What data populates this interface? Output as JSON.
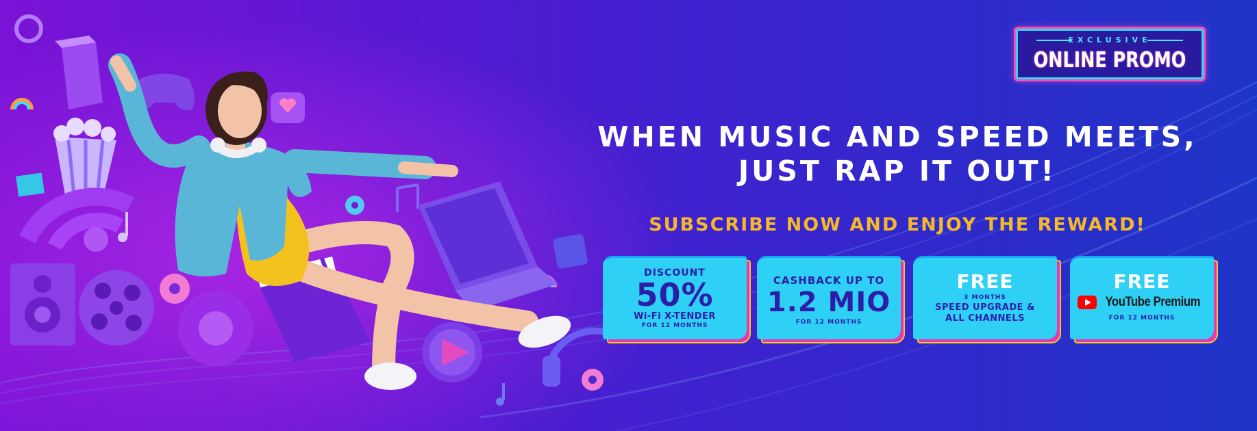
{
  "badge": {
    "top_text": "EXCLUSIVE",
    "main_text": "ONLINE PROMO"
  },
  "headline": {
    "line1": "WHEN MUSIC AND SPEED MEETS,",
    "line2": "JUST RAP IT OUT!"
  },
  "subheadline": "SUBSCRIBE NOW AND ENJOY THE REWARD!",
  "offers": [
    {
      "top": "DISCOUNT",
      "big": "50%",
      "mid": "Wi-Fi X-TENDER",
      "bottom": "FOR 12 MONTHS"
    },
    {
      "top": "CASHBACK UP TO",
      "big": "1.2 MIO",
      "bottom": "FOR 12 MONTHS"
    },
    {
      "big": "FREE",
      "tiny": "3 MONTHS",
      "mid_line1": "SPEED UPGRADE &",
      "mid_line2": "ALL CHANNELS"
    },
    {
      "big": "FREE",
      "brand": "YouTube Premium",
      "bottom": "FOR 12 MONTHS"
    }
  ],
  "colors": {
    "accent_yellow": "#f4b92a",
    "card_cyan": "#2fd0f5",
    "card_pink": "#e33ab0",
    "text_navy": "#2b1ea8",
    "youtube_red": "#ff0000"
  },
  "icons": [
    "popcorn-icon",
    "gamepad-icon",
    "heart-bubble-icon",
    "wifi-icon",
    "music-note-icon",
    "speaker-icon",
    "film-reel-icon",
    "clapperboard-icon",
    "laptop-icon",
    "play-button-icon",
    "headphones-icon",
    "donut-icon"
  ]
}
